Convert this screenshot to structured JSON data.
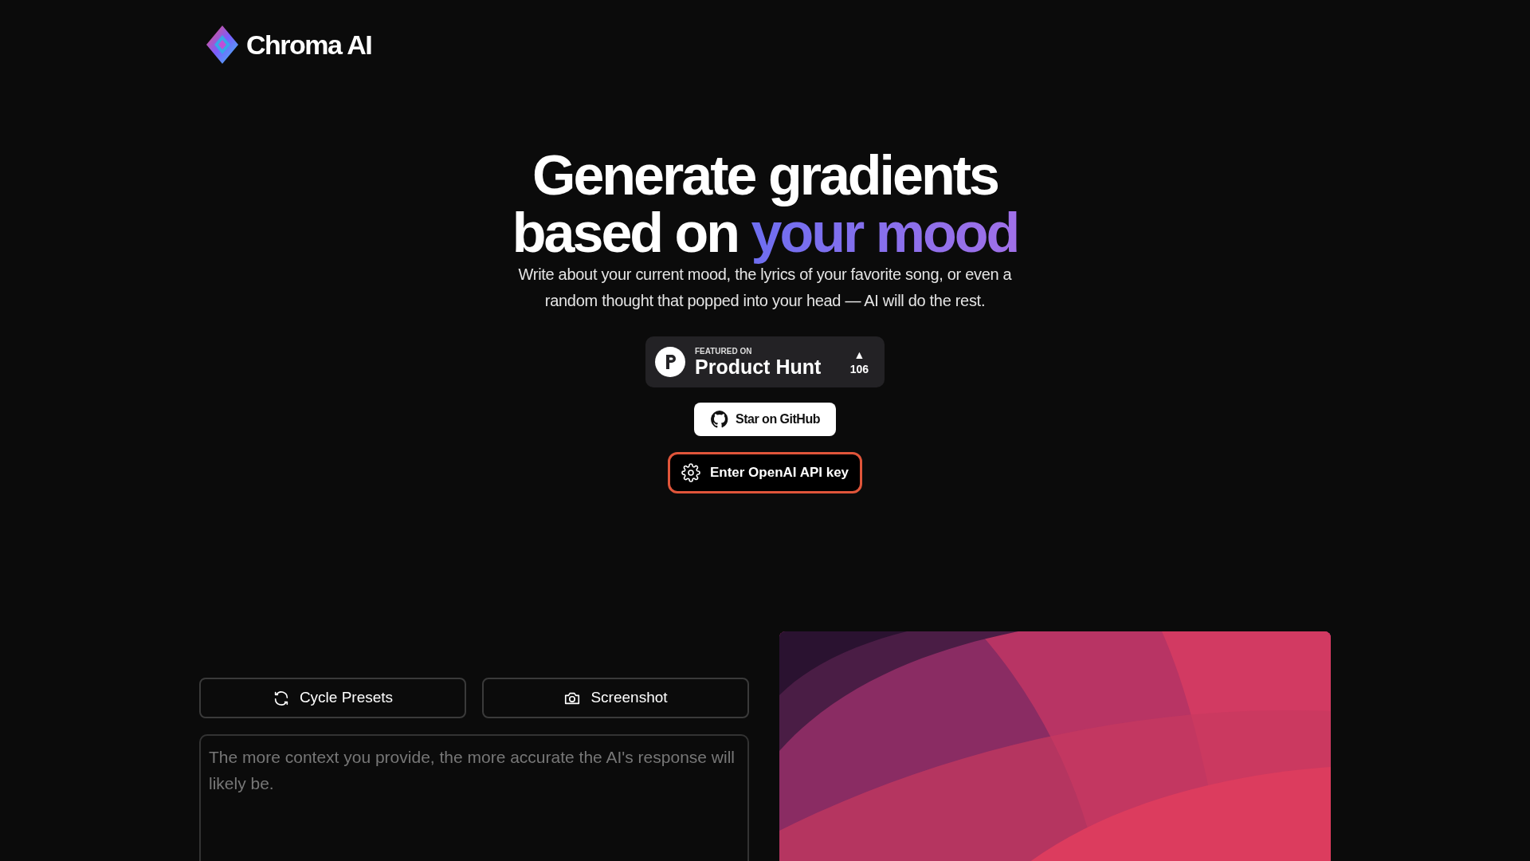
{
  "brand": {
    "name": "Chroma AI"
  },
  "hero": {
    "line1": "Generate gradients",
    "line2": "based on",
    "highlight": "your mood",
    "subtitle": "Write about your current mood, the lyrics of your favorite song, or even a random thought that popped into your head — AI will do the rest."
  },
  "product_hunt": {
    "kicker": "FEATURED ON",
    "name": "Product Hunt",
    "arrow": "▲",
    "votes": "106"
  },
  "buttons": [
    {
      "kind": "github",
      "label": "Star on GitHub"
    },
    {
      "kind": "apikey",
      "label": "Enter OpenAI API key"
    }
  ],
  "tools": [
    {
      "kind": "cycle",
      "label": "Cycle Presets"
    },
    {
      "kind": "camera",
      "label": "Screenshot"
    }
  ],
  "prompt": {
    "placeholder": "The more context you provide, the more accurate the AI's response will likely be."
  }
}
